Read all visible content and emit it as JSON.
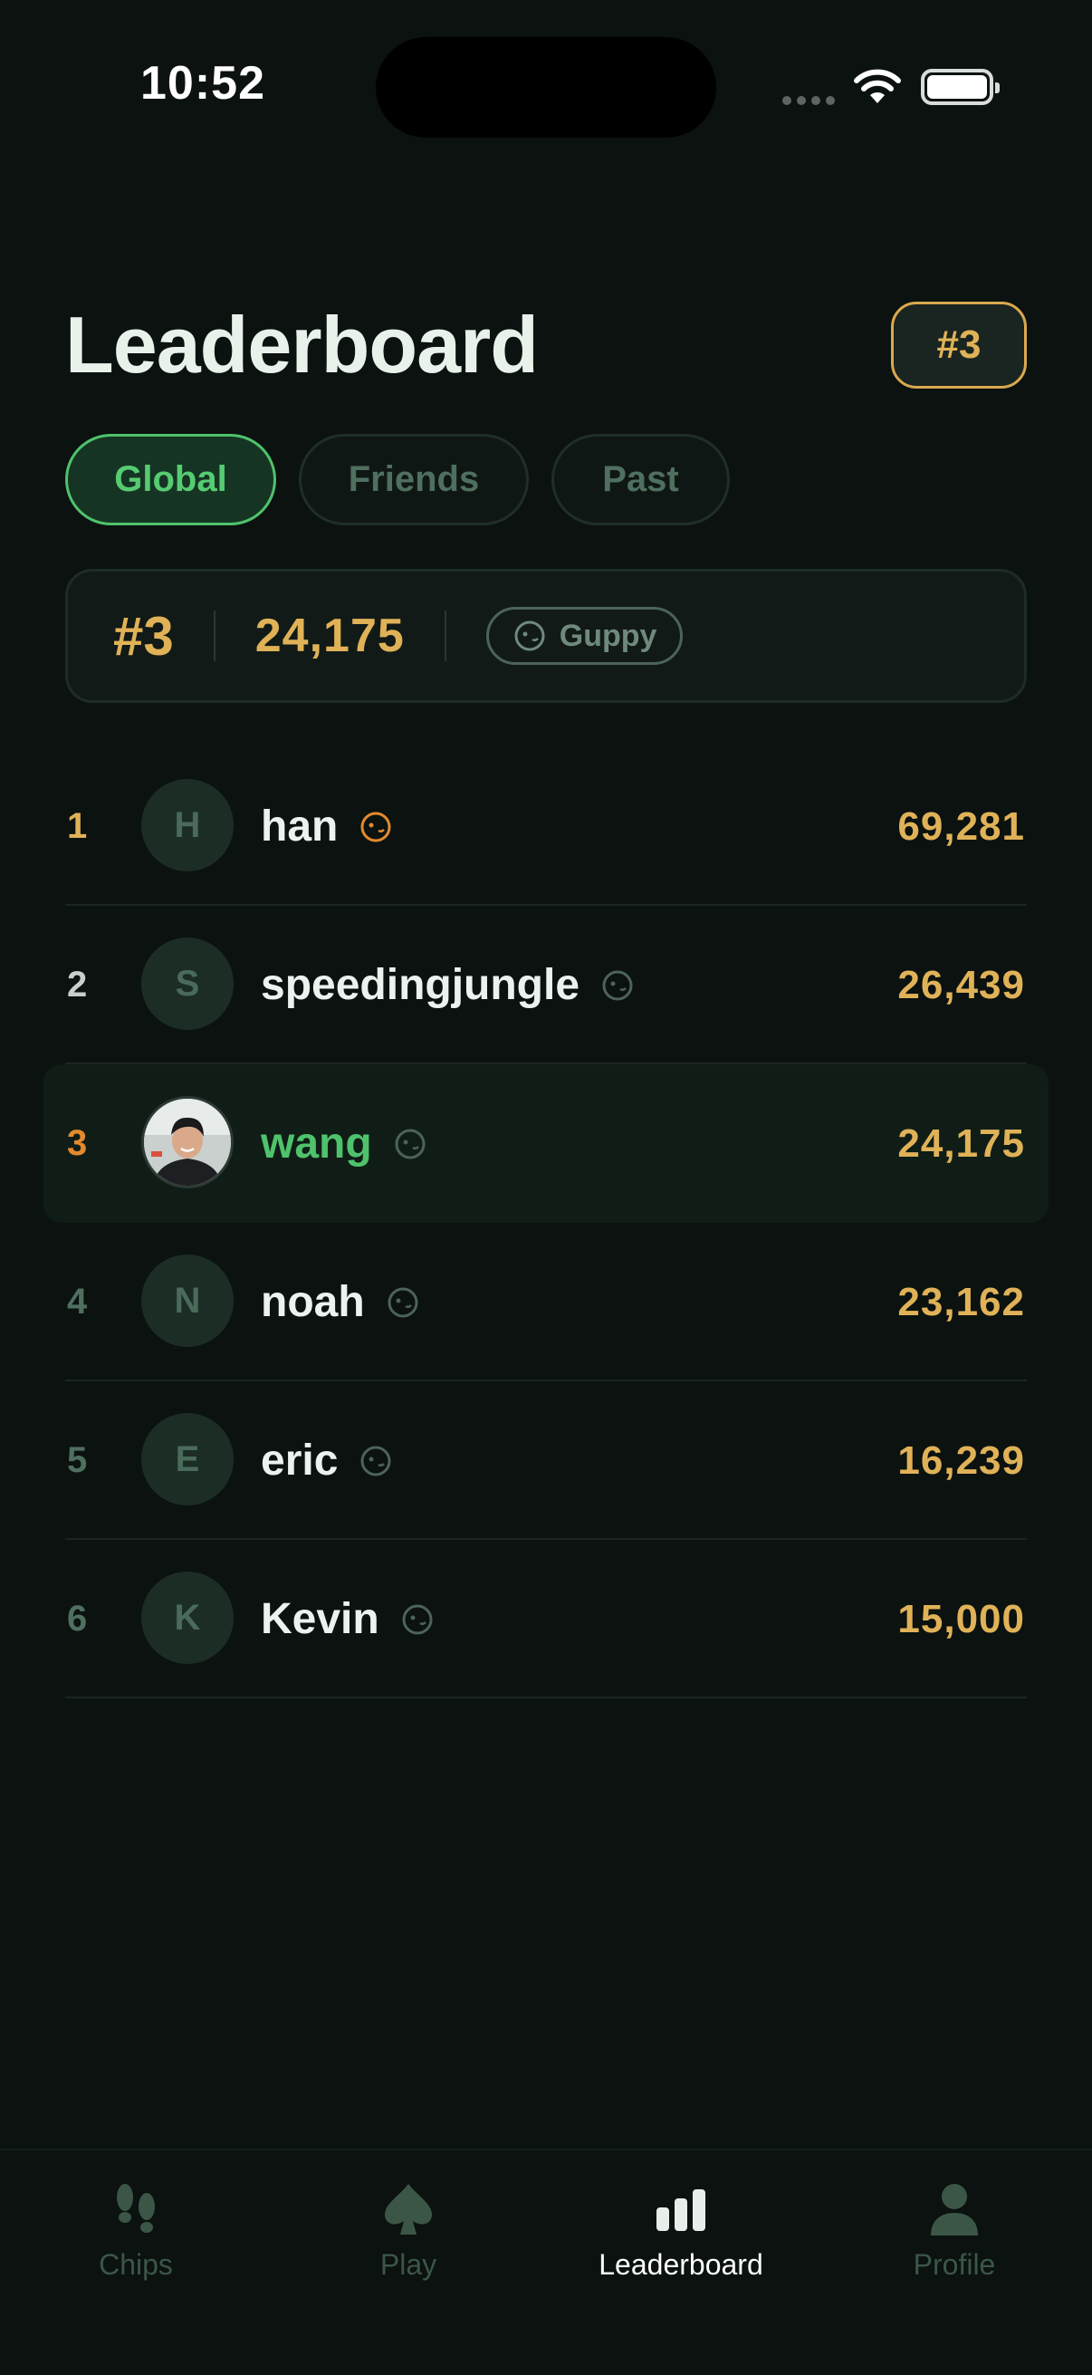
{
  "status_bar": {
    "time": "10:52"
  },
  "header": {
    "title": "Leaderboard",
    "rank_badge": "#3"
  },
  "tabs": [
    {
      "label": "Global",
      "active": true
    },
    {
      "label": "Friends",
      "active": false
    },
    {
      "label": "Past",
      "active": false
    }
  ],
  "summary": {
    "rank": "#3",
    "score": "24,175",
    "tier": "Guppy"
  },
  "rows": [
    {
      "rank": "1",
      "initial": "H",
      "name": "han",
      "score": "69,281",
      "rank_color": "#e0b257",
      "icon_color": "#e38a2e"
    },
    {
      "rank": "2",
      "initial": "S",
      "name": "speedingjungle",
      "score": "26,439",
      "rank_color": "#c9cfcc",
      "icon_color": "#4d6358"
    },
    {
      "rank": "3",
      "initial": "",
      "name": "wang",
      "score": "24,175",
      "rank_color": "#e38a2e",
      "icon_color": "#4d6358",
      "is_current_user": true
    },
    {
      "rank": "4",
      "initial": "N",
      "name": "noah",
      "score": "23,162",
      "rank_color": "#4f6f5f",
      "icon_color": "#4d6358"
    },
    {
      "rank": "5",
      "initial": "E",
      "name": "eric",
      "score": "16,239",
      "rank_color": "#4f6f5f",
      "icon_color": "#4d6358"
    },
    {
      "rank": "6",
      "initial": "K",
      "name": "Kevin",
      "score": "15,000",
      "rank_color": "#4f6f5f",
      "icon_color": "#4d6358"
    }
  ],
  "tab_bar": [
    {
      "label": "Chips",
      "icon": "footprints-icon",
      "active": false
    },
    {
      "label": "Play",
      "icon": "spade-icon",
      "active": false
    },
    {
      "label": "Leaderboard",
      "icon": "bar-chart-icon",
      "active": true
    },
    {
      "label": "Profile",
      "icon": "person-icon",
      "active": false
    }
  ],
  "colors": {
    "accent_green": "#4fc26c",
    "gold": "#e0b257",
    "background": "#0b1210"
  }
}
